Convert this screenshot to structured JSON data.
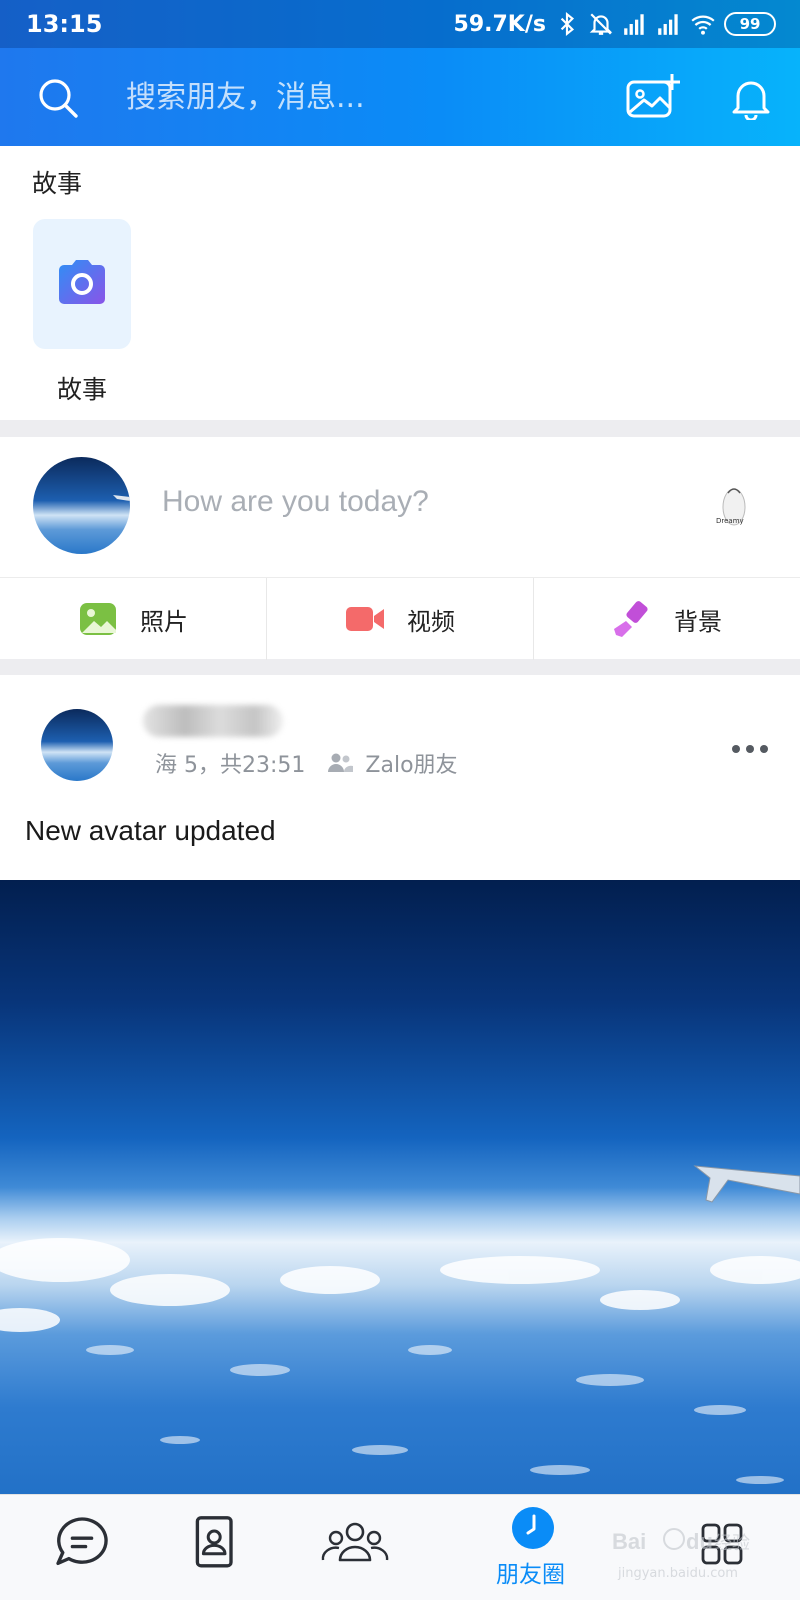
{
  "status_bar": {
    "time": "13:15",
    "network_speed": "59.7K/s",
    "battery": "99"
  },
  "header": {
    "search_placeholder": "搜索朋友，消息...",
    "icons": [
      "search-icon",
      "photo-add-icon",
      "bell-icon"
    ]
  },
  "stories": {
    "title": "故事",
    "items": [
      {
        "label": "故事",
        "icon": "camera-icon"
      }
    ]
  },
  "composer": {
    "placeholder": "How are you today?",
    "sticker_text": "Dreamy"
  },
  "actions": [
    {
      "label": "照片",
      "icon": "photo-icon",
      "color": "#7bc043"
    },
    {
      "label": "视频",
      "icon": "video-icon",
      "color": "#f46a6a"
    },
    {
      "label": "背景",
      "icon": "brush-icon",
      "color": "#c14fd8"
    }
  ],
  "post": {
    "author_name": "",
    "timestamp": "海 5，共23:51",
    "audience": "Zalo朋友",
    "text": "New avatar updated"
  },
  "bottom_nav": {
    "items": [
      {
        "name": "messages",
        "icon": "chat-icon"
      },
      {
        "name": "contacts",
        "icon": "contact-icon"
      },
      {
        "name": "groups",
        "icon": "group-icon"
      },
      {
        "name": "timeline",
        "icon": "clock-icon",
        "label": "朋友圈",
        "active": true
      },
      {
        "name": "more",
        "icon": "grid-icon"
      }
    ],
    "active_label": "朋友圈"
  },
  "watermark": {
    "brand": "Bai",
    "brand_suffix": "du",
    "brand_cn": "经验",
    "url": "jingyan.baidu.com"
  },
  "colors": {
    "accent": "#0a8cf7",
    "header_gradient_start": "#1f78ee",
    "header_gradient_end": "#07b3fb"
  }
}
